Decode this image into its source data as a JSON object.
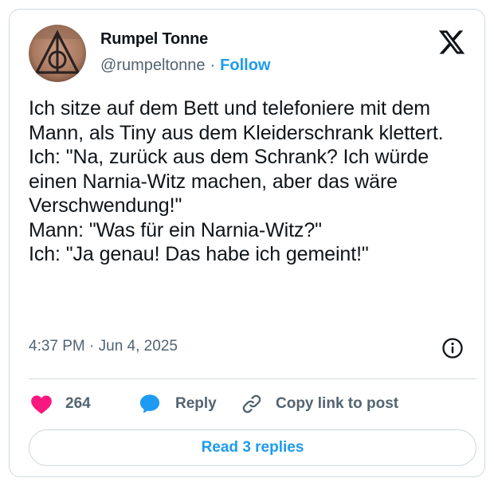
{
  "author": {
    "name": "Rumpel Tonne",
    "handle": "@rumpeltonne",
    "separator": "·",
    "follow_label": "Follow"
  },
  "tweet": {
    "text": "Ich sitze auf dem Bett und telefoniere mit dem Mann, als Tiny aus dem Kleiderschrank klettert.\nIch: \"Na, zurück aus dem Schrank? Ich würde einen Narnia-Witz machen, aber das wäre Verschwendung!\"\nMann: \"Was für ein Narnia-Witz?\"\nIch: \"Ja genau! Das habe ich gemeint!\"",
    "timestamp": "4:37 PM · Jun 4, 2025"
  },
  "actions": {
    "like_count": "264",
    "reply_label": "Reply",
    "copy_label": "Copy link to post"
  },
  "read_replies_label": "Read 3 replies",
  "icons": {
    "logo": "x-logo-icon",
    "info": "info-icon",
    "like": "heart-icon",
    "reply": "speech-bubble-icon",
    "copy": "link-icon"
  },
  "colors": {
    "accent": "#1d9bf0",
    "heart": "#f91880",
    "text": "#0f1419",
    "secondary": "#536471",
    "border": "#cfd9de"
  }
}
